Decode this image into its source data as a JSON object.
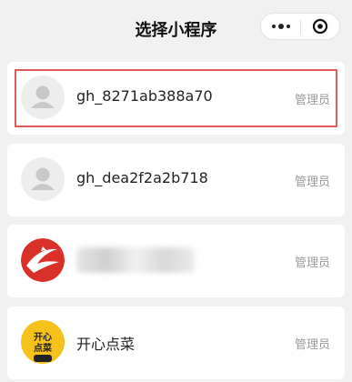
{
  "header": {
    "title": "选择小程序"
  },
  "items": [
    {
      "name": "gh_8271ab388a70",
      "role": "管理员",
      "avatar": "default-person-icon"
    },
    {
      "name": "gh_dea2f2a2b718",
      "role": "管理员",
      "avatar": "default-person-icon"
    },
    {
      "name": "",
      "role": "管理员",
      "avatar": "red-swoosh-logo"
    },
    {
      "name": "开心点菜",
      "role": "管理员",
      "avatar": "happy-order-logo",
      "avatar_text": [
        "开心",
        "点菜"
      ]
    }
  ],
  "colors": {
    "selected_border": "#e05a5a",
    "background": "#f1f1f1",
    "logo_yellow": "#f4c21a",
    "logo_red": "#d9302a"
  }
}
